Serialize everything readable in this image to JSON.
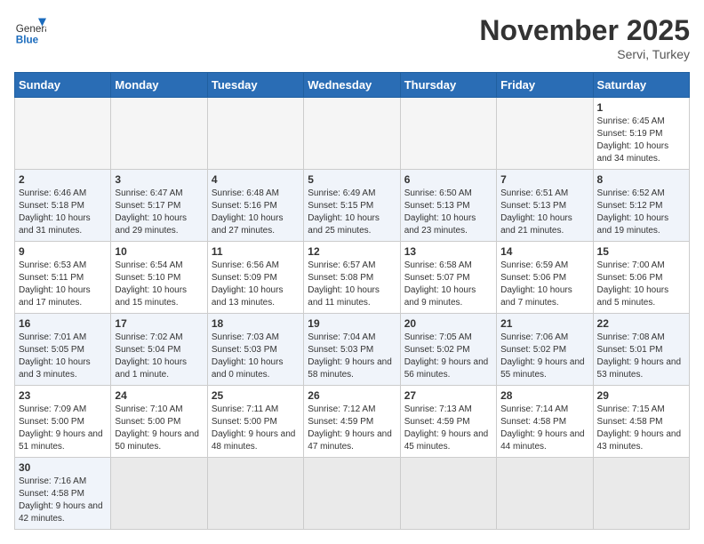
{
  "header": {
    "logo_general": "General",
    "logo_blue": "Blue",
    "month_year": "November 2025",
    "location": "Servi, Turkey"
  },
  "weekdays": [
    "Sunday",
    "Monday",
    "Tuesday",
    "Wednesday",
    "Thursday",
    "Friday",
    "Saturday"
  ],
  "weeks": [
    [
      {
        "day": "",
        "info": ""
      },
      {
        "day": "",
        "info": ""
      },
      {
        "day": "",
        "info": ""
      },
      {
        "day": "",
        "info": ""
      },
      {
        "day": "",
        "info": ""
      },
      {
        "day": "",
        "info": ""
      },
      {
        "day": "1",
        "info": "Sunrise: 6:45 AM\nSunset: 5:19 PM\nDaylight: 10 hours and 34 minutes."
      }
    ],
    [
      {
        "day": "2",
        "info": "Sunrise: 6:46 AM\nSunset: 5:18 PM\nDaylight: 10 hours and 31 minutes."
      },
      {
        "day": "3",
        "info": "Sunrise: 6:47 AM\nSunset: 5:17 PM\nDaylight: 10 hours and 29 minutes."
      },
      {
        "day": "4",
        "info": "Sunrise: 6:48 AM\nSunset: 5:16 PM\nDaylight: 10 hours and 27 minutes."
      },
      {
        "day": "5",
        "info": "Sunrise: 6:49 AM\nSunset: 5:15 PM\nDaylight: 10 hours and 25 minutes."
      },
      {
        "day": "6",
        "info": "Sunrise: 6:50 AM\nSunset: 5:13 PM\nDaylight: 10 hours and 23 minutes."
      },
      {
        "day": "7",
        "info": "Sunrise: 6:51 AM\nSunset: 5:13 PM\nDaylight: 10 hours and 21 minutes."
      },
      {
        "day": "8",
        "info": "Sunrise: 6:52 AM\nSunset: 5:12 PM\nDaylight: 10 hours and 19 minutes."
      }
    ],
    [
      {
        "day": "9",
        "info": "Sunrise: 6:53 AM\nSunset: 5:11 PM\nDaylight: 10 hours and 17 minutes."
      },
      {
        "day": "10",
        "info": "Sunrise: 6:54 AM\nSunset: 5:10 PM\nDaylight: 10 hours and 15 minutes."
      },
      {
        "day": "11",
        "info": "Sunrise: 6:56 AM\nSunset: 5:09 PM\nDaylight: 10 hours and 13 minutes."
      },
      {
        "day": "12",
        "info": "Sunrise: 6:57 AM\nSunset: 5:08 PM\nDaylight: 10 hours and 11 minutes."
      },
      {
        "day": "13",
        "info": "Sunrise: 6:58 AM\nSunset: 5:07 PM\nDaylight: 10 hours and 9 minutes."
      },
      {
        "day": "14",
        "info": "Sunrise: 6:59 AM\nSunset: 5:06 PM\nDaylight: 10 hours and 7 minutes."
      },
      {
        "day": "15",
        "info": "Sunrise: 7:00 AM\nSunset: 5:06 PM\nDaylight: 10 hours and 5 minutes."
      }
    ],
    [
      {
        "day": "16",
        "info": "Sunrise: 7:01 AM\nSunset: 5:05 PM\nDaylight: 10 hours and 3 minutes."
      },
      {
        "day": "17",
        "info": "Sunrise: 7:02 AM\nSunset: 5:04 PM\nDaylight: 10 hours and 1 minute."
      },
      {
        "day": "18",
        "info": "Sunrise: 7:03 AM\nSunset: 5:03 PM\nDaylight: 10 hours and 0 minutes."
      },
      {
        "day": "19",
        "info": "Sunrise: 7:04 AM\nSunset: 5:03 PM\nDaylight: 9 hours and 58 minutes."
      },
      {
        "day": "20",
        "info": "Sunrise: 7:05 AM\nSunset: 5:02 PM\nDaylight: 9 hours and 56 minutes."
      },
      {
        "day": "21",
        "info": "Sunrise: 7:06 AM\nSunset: 5:02 PM\nDaylight: 9 hours and 55 minutes."
      },
      {
        "day": "22",
        "info": "Sunrise: 7:08 AM\nSunset: 5:01 PM\nDaylight: 9 hours and 53 minutes."
      }
    ],
    [
      {
        "day": "23",
        "info": "Sunrise: 7:09 AM\nSunset: 5:00 PM\nDaylight: 9 hours and 51 minutes."
      },
      {
        "day": "24",
        "info": "Sunrise: 7:10 AM\nSunset: 5:00 PM\nDaylight: 9 hours and 50 minutes."
      },
      {
        "day": "25",
        "info": "Sunrise: 7:11 AM\nSunset: 5:00 PM\nDaylight: 9 hours and 48 minutes."
      },
      {
        "day": "26",
        "info": "Sunrise: 7:12 AM\nSunset: 4:59 PM\nDaylight: 9 hours and 47 minutes."
      },
      {
        "day": "27",
        "info": "Sunrise: 7:13 AM\nSunset: 4:59 PM\nDaylight: 9 hours and 45 minutes."
      },
      {
        "day": "28",
        "info": "Sunrise: 7:14 AM\nSunset: 4:58 PM\nDaylight: 9 hours and 44 minutes."
      },
      {
        "day": "29",
        "info": "Sunrise: 7:15 AM\nSunset: 4:58 PM\nDaylight: 9 hours and 43 minutes."
      }
    ],
    [
      {
        "day": "30",
        "info": "Sunrise: 7:16 AM\nSunset: 4:58 PM\nDaylight: 9 hours and 42 minutes."
      },
      {
        "day": "",
        "info": ""
      },
      {
        "day": "",
        "info": ""
      },
      {
        "day": "",
        "info": ""
      },
      {
        "day": "",
        "info": ""
      },
      {
        "day": "",
        "info": ""
      },
      {
        "day": "",
        "info": ""
      }
    ]
  ]
}
